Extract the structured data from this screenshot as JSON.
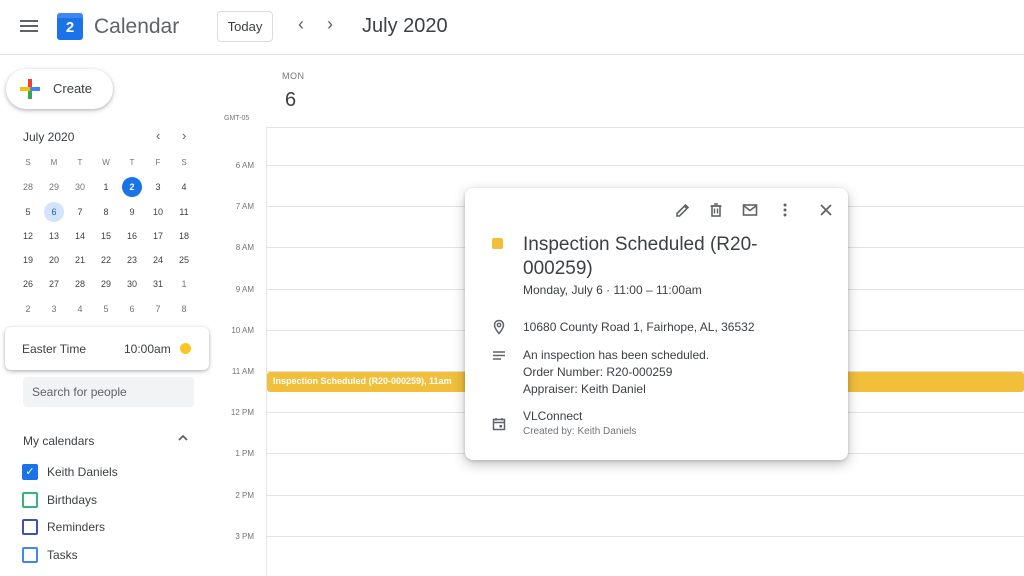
{
  "header": {
    "app_title": "Calendar",
    "logo_day": "2",
    "today_label": "Today",
    "prev_arrow": "‹",
    "next_arrow": "›",
    "month_title": "July 2020"
  },
  "sidebar": {
    "create_label": "Create",
    "mini_cal": {
      "title": "July 2020",
      "prev": "‹",
      "next": "›",
      "dow": [
        "S",
        "M",
        "T",
        "W",
        "T",
        "F",
        "S"
      ],
      "weeks": [
        [
          "28",
          "29",
          "30",
          "1",
          "2",
          "3",
          "4"
        ],
        [
          "5",
          "6",
          "7",
          "8",
          "9",
          "10",
          "11"
        ],
        [
          "12",
          "13",
          "14",
          "15",
          "16",
          "17",
          "18"
        ],
        [
          "19",
          "20",
          "21",
          "22",
          "23",
          "24",
          "25"
        ],
        [
          "26",
          "27",
          "28",
          "29",
          "30",
          "31",
          "1"
        ],
        [
          "2",
          "3",
          "4",
          "5",
          "6",
          "7",
          "8"
        ]
      ],
      "today": "2",
      "selected": "6"
    },
    "timezone": {
      "label": "Easter Time",
      "time": "10:00am"
    },
    "people_search_placeholder": "Search for people",
    "my_calendars": {
      "title": "My calendars",
      "items": [
        {
          "label": "Keith Daniels",
          "color": "#1a73e8",
          "checked": true
        },
        {
          "label": "Birthdays",
          "color": "#33b679",
          "checked": false
        },
        {
          "label": "Reminders",
          "color": "#3f51b5",
          "checked": false
        },
        {
          "label": "Tasks",
          "color": "#4285f4",
          "checked": false
        }
      ]
    }
  },
  "day_view": {
    "dow": "MON",
    "day_num": "6",
    "tz_label": "GMT-05",
    "hours": [
      "6 AM",
      "7 AM",
      "8 AM",
      "9 AM",
      "10 AM",
      "11 AM",
      "12 PM",
      "1 PM",
      "2 PM",
      "3 PM"
    ],
    "event_bar_text": "Inspection Scheduled (R20-000259), 11am"
  },
  "popup": {
    "title": "Inspection Scheduled (R20-000259)",
    "date": "Monday, July 6  ·  11:00 – 11:00am",
    "location": "10680 County Road 1, Fairhope, AL, 36532",
    "description_lines": [
      "An inspection has been scheduled.",
      "Order Number: R20-000259",
      "Appraiser: Keith Daniel"
    ],
    "calendar_name": "VLConnect",
    "created_by": "Created by: Keith Daniels",
    "event_color": "#f1bf3a"
  }
}
